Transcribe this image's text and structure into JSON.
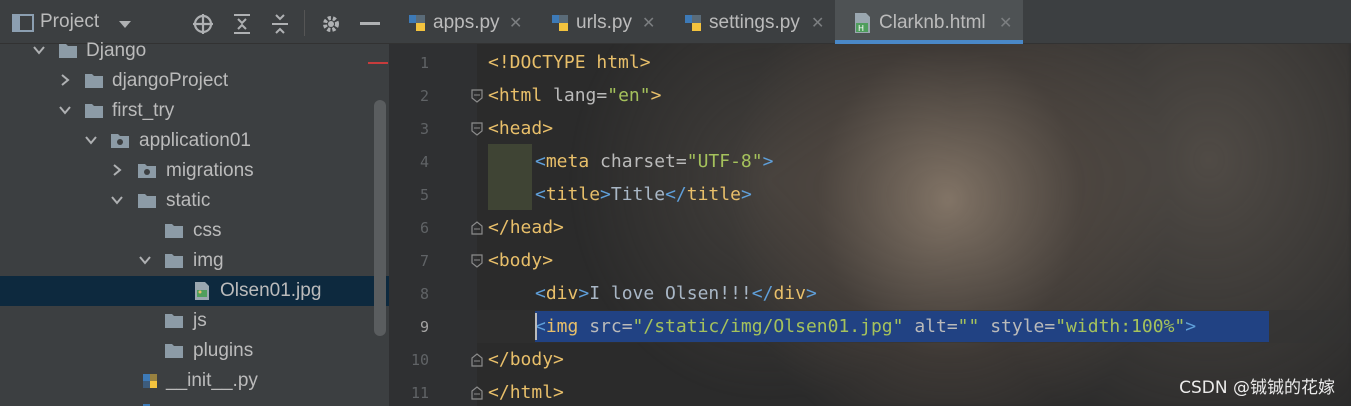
{
  "project_panel": {
    "title": "Project",
    "toolbar_icons": [
      "locate-icon",
      "expand-all-icon",
      "collapse-all-icon",
      "gear-icon",
      "minimize-icon"
    ],
    "tree": [
      {
        "label": "Django",
        "type": "folder",
        "expanded": true
      },
      {
        "label": "djangoProject",
        "type": "folder",
        "expanded": false
      },
      {
        "label": "first_try",
        "type": "folder",
        "expanded": true
      },
      {
        "label": "application01",
        "type": "package",
        "expanded": true
      },
      {
        "label": "migrations",
        "type": "package",
        "expanded": false
      },
      {
        "label": "static",
        "type": "folder",
        "expanded": true
      },
      {
        "label": "css",
        "type": "folder"
      },
      {
        "label": "img",
        "type": "folder",
        "expanded": true
      },
      {
        "label": "Olsen01.jpg",
        "type": "image-file",
        "selected": true
      },
      {
        "label": "js",
        "type": "folder"
      },
      {
        "label": "plugins",
        "type": "folder"
      },
      {
        "label": "__init__.py",
        "type": "python-file"
      }
    ]
  },
  "tabs": [
    {
      "label": "apps.py",
      "icon": "python-file-icon",
      "active": false
    },
    {
      "label": "urls.py",
      "icon": "python-file-icon",
      "active": false
    },
    {
      "label": "settings.py",
      "icon": "python-file-icon",
      "active": false
    },
    {
      "label": "Clarknb.html",
      "icon": "html-file-icon",
      "active": true
    }
  ],
  "editor": {
    "line_numbers": [
      "1",
      "2",
      "3",
      "4",
      "5",
      "6",
      "7",
      "8",
      "9",
      "10",
      "11"
    ],
    "current_line": 9,
    "lines": {
      "l1": "<!DOCTYPE html>",
      "l2_tag": "html",
      "l2_attr": " lang=",
      "l2_val": "\"en\"",
      "l3_tag": "head",
      "l4_tag": "meta",
      "l4_attr": " charset=",
      "l4_val": "\"UTF-8\"",
      "l5_tag": "title",
      "l5_text": "Title",
      "l6_tag": "head",
      "l7_tag": "body",
      "l8_tag": "div",
      "l8_text": "I love Olsen!!!",
      "l9_tag": "img",
      "l9_attr1": " src=",
      "l9_val1": "\"/static/img/Olsen01.jpg\"",
      "l9_attr2": " alt=",
      "l9_val2": "\"\"",
      "l9_attr3": " style=",
      "l9_val3": "\"width:100%\"",
      "l10_tag": "body",
      "l11_tag": "html"
    }
  },
  "watermark": "CSDN @铖铖的花嫁",
  "colors": {
    "panel_bg": "#3c3f41",
    "editor_bg": "#2b2b2b",
    "selection": "#214283",
    "tag": "#e8bf6a",
    "string": "#a5c25c",
    "active_tab_underline": "#4a88c7"
  }
}
